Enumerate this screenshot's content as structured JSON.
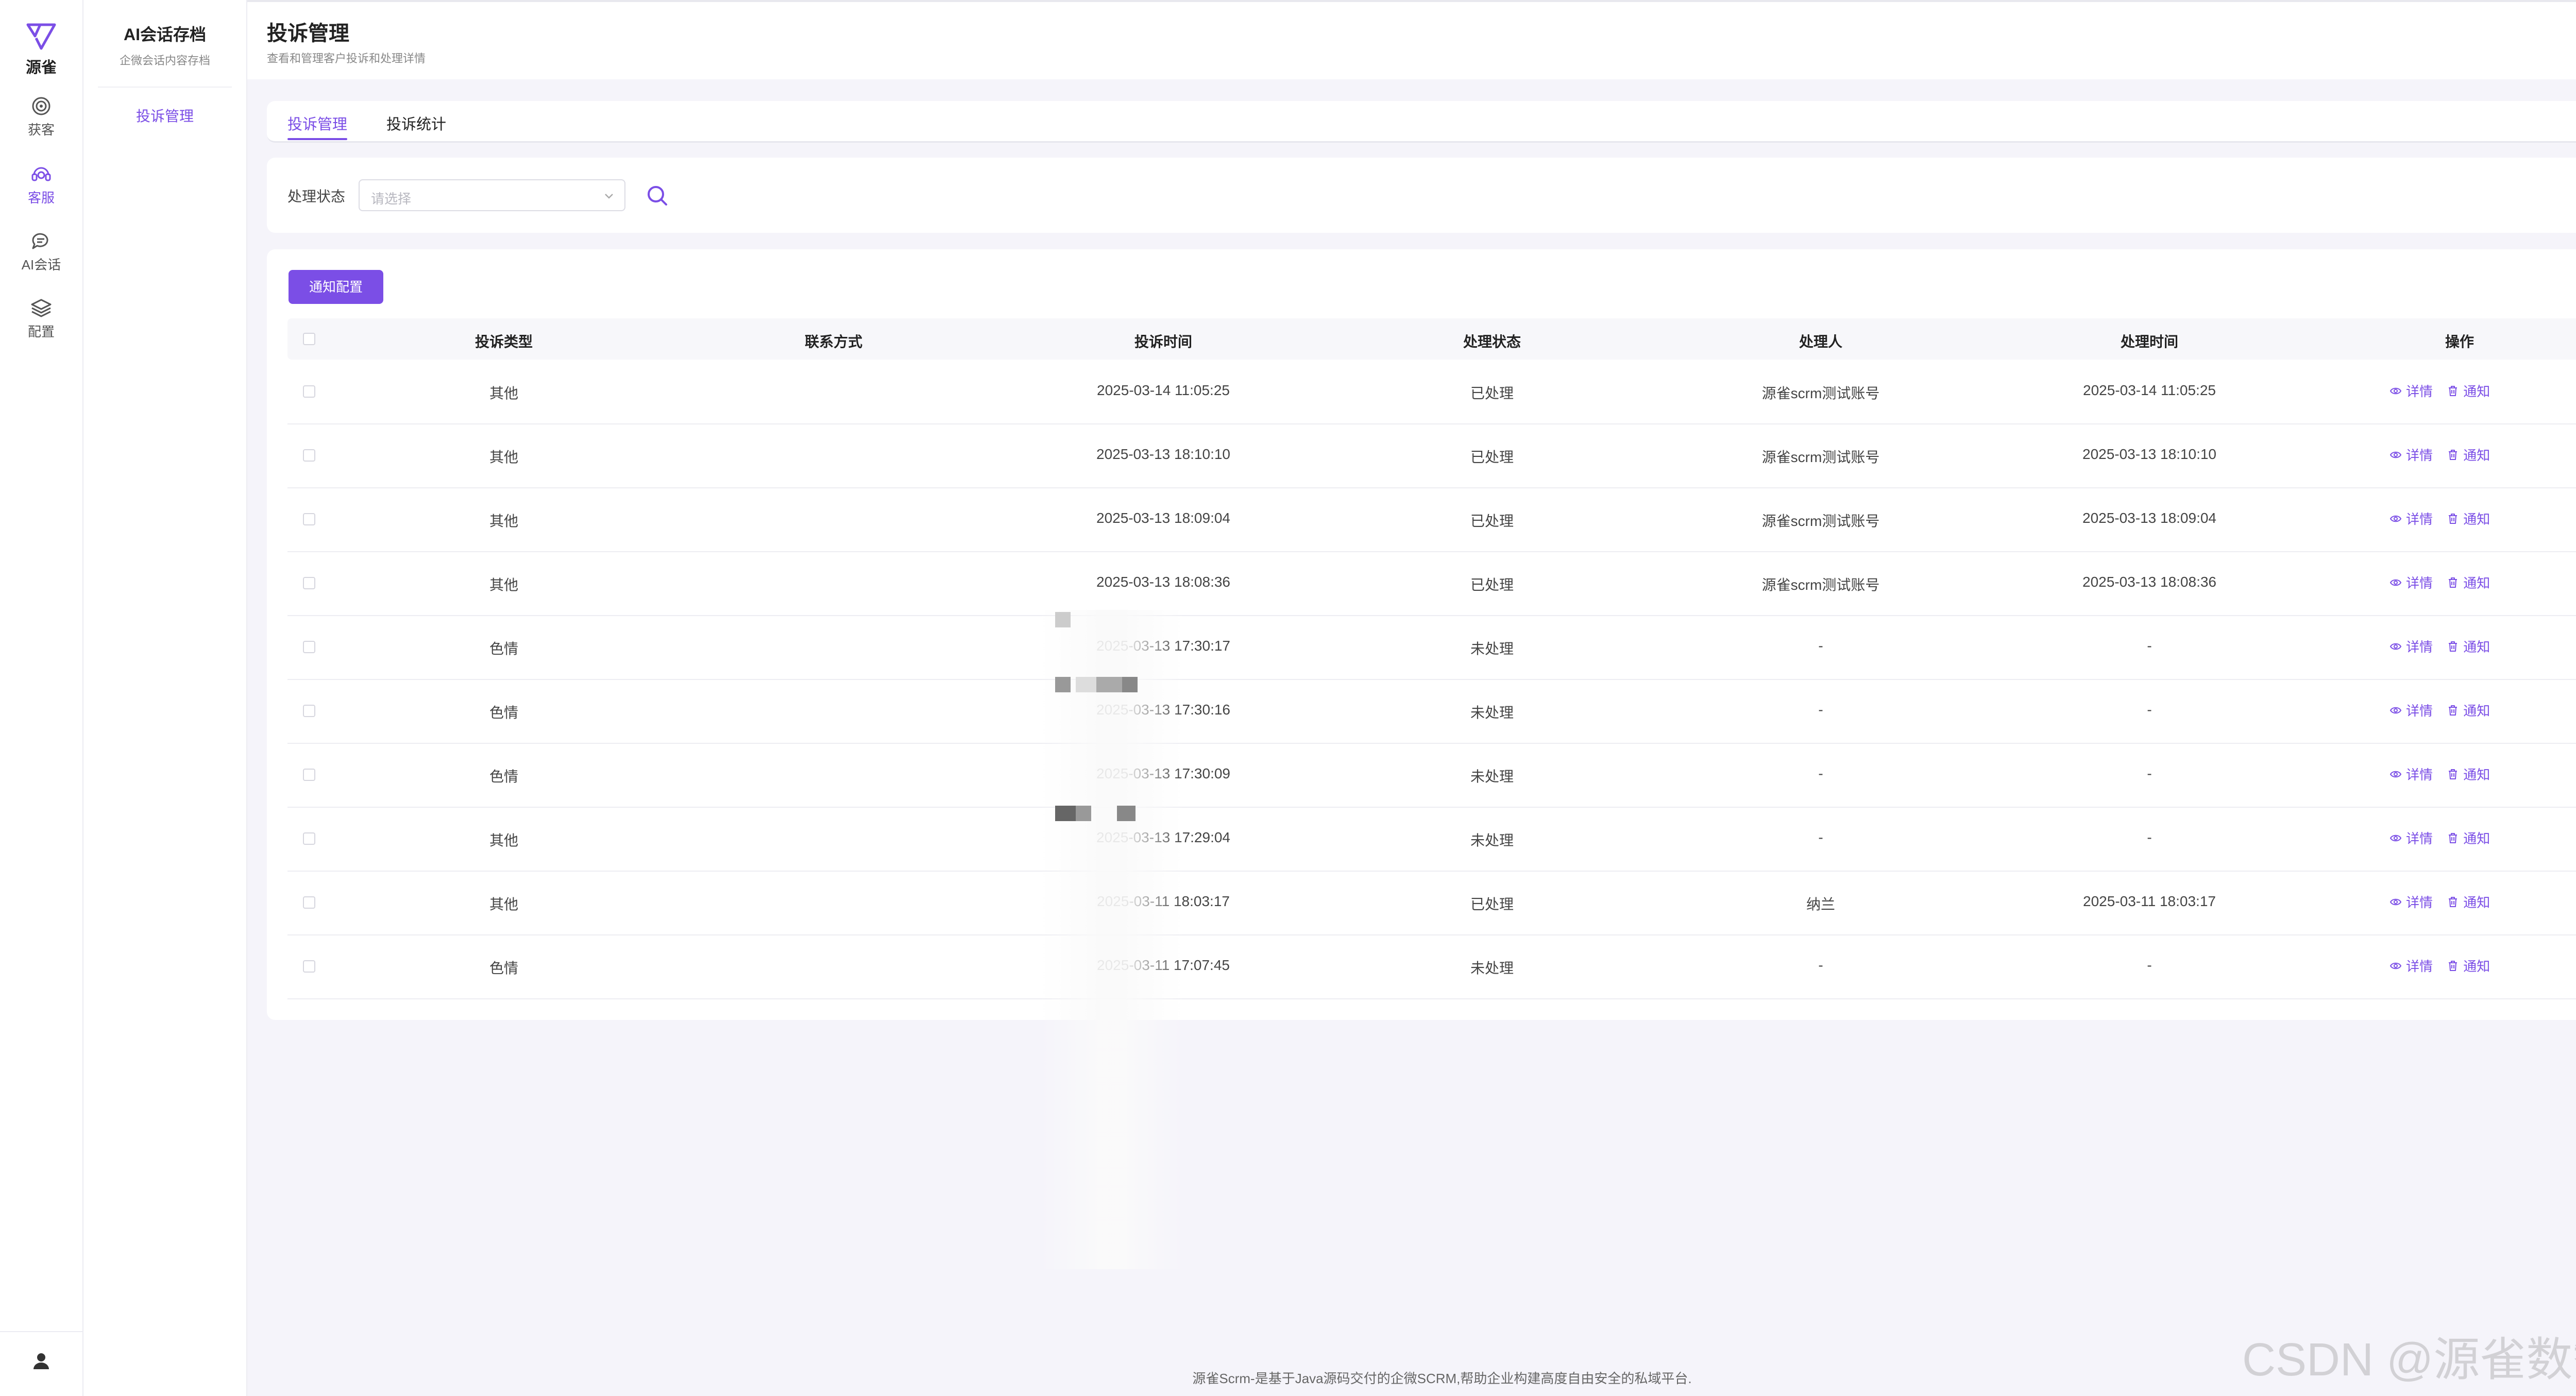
{
  "brand": {
    "name": "源雀"
  },
  "rail": {
    "items": [
      {
        "label": "获客",
        "icon": "target-icon"
      },
      {
        "label": "客服",
        "icon": "headset-icon",
        "active": true
      },
      {
        "label": "AI会话",
        "icon": "chat-icon"
      },
      {
        "label": "配置",
        "icon": "layers-icon"
      }
    ]
  },
  "subnav": {
    "title": "AI会话存档",
    "subtitle": "企微会话内容存档",
    "items": [
      {
        "label": "投诉管理",
        "active": true
      }
    ]
  },
  "header": {
    "title": "投诉管理",
    "subtitle": "查看和管理客户投诉和处理详情"
  },
  "tabs": [
    {
      "label": "投诉管理",
      "active": true
    },
    {
      "label": "投诉统计",
      "active": false
    }
  ],
  "filter": {
    "label": "处理状态",
    "placeholder": "请选择"
  },
  "toolbar": {
    "notify_config_label": "通知配置"
  },
  "table": {
    "columns": [
      "投诉类型",
      "联系方式",
      "投诉时间",
      "处理状态",
      "处理人",
      "处理时间",
      "操作"
    ],
    "actions": {
      "detail": "详情",
      "notify": "通知"
    },
    "rows": [
      {
        "type": "其他",
        "contact": "",
        "time": "2025-03-14 11:05:25",
        "status": "已处理",
        "handler": "源雀scrm测试账号",
        "handled_time": "2025-03-14 11:05:25"
      },
      {
        "type": "其他",
        "contact": "",
        "time": "2025-03-13 18:10:10",
        "status": "已处理",
        "handler": "源雀scrm测试账号",
        "handled_time": "2025-03-13 18:10:10"
      },
      {
        "type": "其他",
        "contact": "",
        "time": "2025-03-13 18:09:04",
        "status": "已处理",
        "handler": "源雀scrm测试账号",
        "handled_time": "2025-03-13 18:09:04"
      },
      {
        "type": "其他",
        "contact": "",
        "time": "2025-03-13 18:08:36",
        "status": "已处理",
        "handler": "源雀scrm测试账号",
        "handled_time": "2025-03-13 18:08:36"
      },
      {
        "type": "色情",
        "contact": "",
        "time": "2025-03-13 17:30:17",
        "status": "未处理",
        "handler": "-",
        "handled_time": "-"
      },
      {
        "type": "色情",
        "contact": "",
        "time": "2025-03-13 17:30:16",
        "status": "未处理",
        "handler": "-",
        "handled_time": "-"
      },
      {
        "type": "色情",
        "contact": "",
        "time": "2025-03-13 17:30:09",
        "status": "未处理",
        "handler": "-",
        "handled_time": "-"
      },
      {
        "type": "其他",
        "contact": "",
        "time": "2025-03-13 17:29:04",
        "status": "未处理",
        "handler": "-",
        "handled_time": "-"
      },
      {
        "type": "其他",
        "contact": "",
        "time": "2025-03-11 18:03:17",
        "status": "已处理",
        "handler": "纳兰",
        "handled_time": "2025-03-11 18:03:17"
      },
      {
        "type": "色情",
        "contact": "",
        "time": "2025-03-11 17:07:45",
        "status": "未处理",
        "handler": "-",
        "handled_time": "-"
      }
    ]
  },
  "footer": {
    "text": "源雀Scrm-是基于Java源码交付的企微SCRM,帮助企业构建高度自由安全的私域平台."
  },
  "watermark": {
    "text": "CSDN @源雀数智"
  },
  "colors": {
    "accent": "#7b4ee6",
    "background": "#f5f4fa"
  }
}
